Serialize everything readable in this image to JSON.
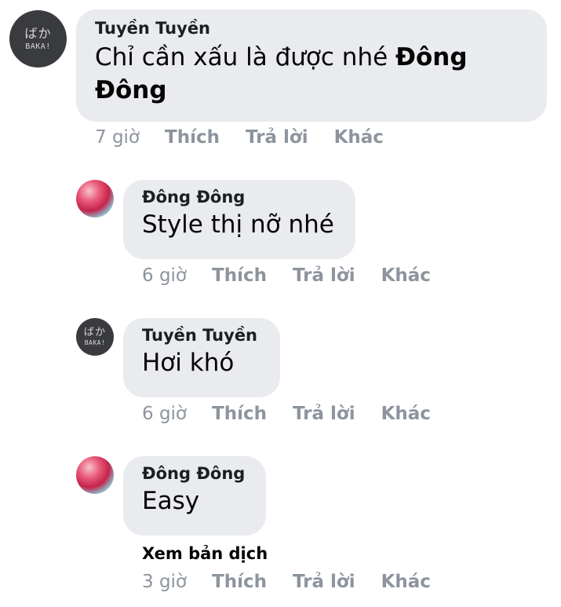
{
  "comments": [
    {
      "author": "Tuyền Tuyền",
      "text": "Chỉ cần xấu là được nhé ",
      "mention": "Đông Đông",
      "time": "7 giờ",
      "like": "Thích",
      "reply": "Trả lời",
      "more": "Khác",
      "avatar": {
        "kana": "ばか",
        "romaji": "BAKA!"
      }
    },
    {
      "author": "Đông Đông",
      "text": "Style thị nỡ nhé",
      "time": "6 giờ",
      "like": "Thích",
      "reply": "Trả lời",
      "more": "Khác"
    },
    {
      "author": "Tuyền Tuyền",
      "text": "Hơi khó",
      "time": "6 giờ",
      "like": "Thích",
      "reply": "Trả lời",
      "more": "Khác",
      "avatar": {
        "kana": "ばか",
        "romaji": "BAKA!"
      }
    },
    {
      "author": "Đông Đông",
      "text": "Easy",
      "see_translation": "Xem bản dịch",
      "time": "3 giờ",
      "like": "Thích",
      "reply": "Trả lời",
      "more": "Khác"
    }
  ],
  "colors": {
    "bubble": "#e9ebee",
    "meta": "#8d949e",
    "text": "#050505"
  }
}
